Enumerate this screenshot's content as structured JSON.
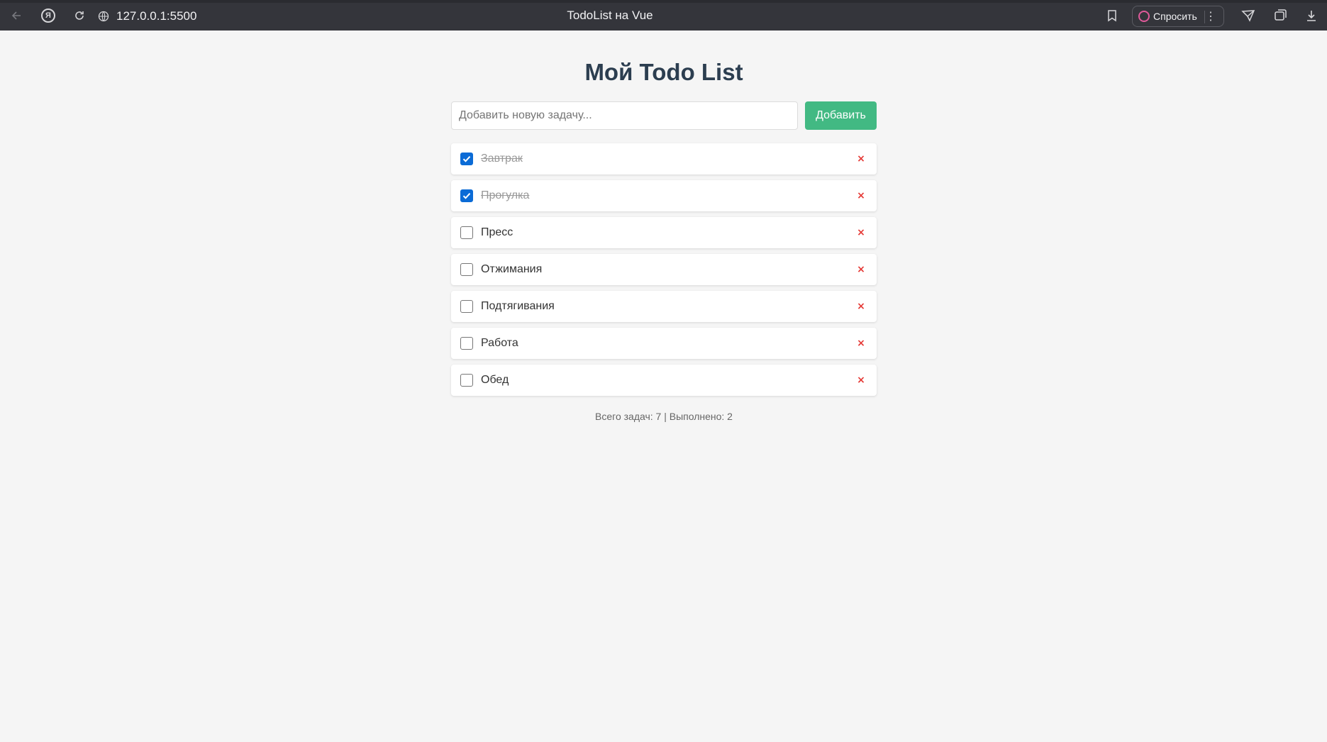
{
  "browser": {
    "url": "127.0.0.1:5500",
    "tab_title": "TodoList на Vue",
    "ask_label": "Спросить",
    "icons": {
      "back": "arrow-left-icon",
      "yandex": "yandex-icon",
      "reload": "reload-icon",
      "site_info": "globe-icon",
      "bookmark": "bookmark-icon",
      "more": "more-vertical-icon",
      "send": "send-icon",
      "tabs": "tabs-icon",
      "download": "download-icon"
    },
    "ya_letter": "Я"
  },
  "app": {
    "title": "Мой Todo List",
    "input_placeholder": "Добавить новую задачу...",
    "add_label": "Добавить",
    "accent_color": "#42b983",
    "delete_symbol": "×",
    "todos": [
      {
        "text": "Завтрак",
        "done": true
      },
      {
        "text": "Прогулка",
        "done": true
      },
      {
        "text": "Пресс",
        "done": false
      },
      {
        "text": "Отжимания",
        "done": false
      },
      {
        "text": "Подтягивания",
        "done": false
      },
      {
        "text": "Работа",
        "done": false
      },
      {
        "text": "Обед",
        "done": false
      }
    ],
    "stats": "Всего задач: 7 | Выполнено: 2"
  }
}
